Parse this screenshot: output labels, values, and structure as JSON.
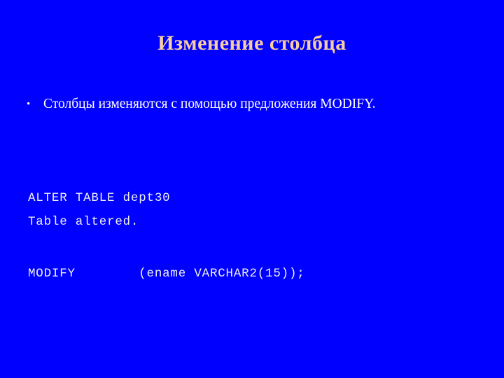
{
  "slide": {
    "background_color": "#0000FF",
    "title": "Изменение столбца",
    "title_color": "#F7CDA2",
    "body_text_color": "#FFFFFF",
    "code_text_color": "#EFF0F5"
  },
  "bullets": [
    {
      "marker": "•",
      "text": "Столбцы изменяются с помощью предложения MODIFY."
    }
  ],
  "code": {
    "lines": [
      "ALTER TABLE dept30",
      "MODIFY        (ename VARCHAR2(15));"
    ]
  },
  "result": {
    "text": "Table altered."
  }
}
